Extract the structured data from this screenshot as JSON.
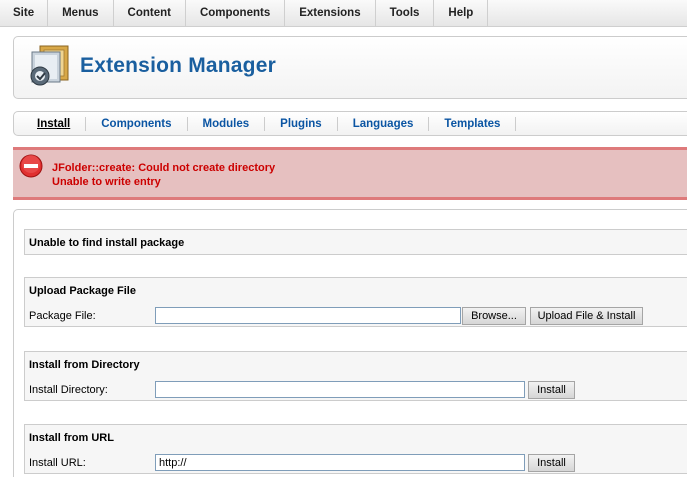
{
  "menu": {
    "items": [
      "Site",
      "Menus",
      "Content",
      "Components",
      "Extensions",
      "Tools",
      "Help"
    ]
  },
  "header": {
    "title": "Extension Manager",
    "icon": "install-package-icon"
  },
  "submenu": {
    "items": [
      "Install",
      "Components",
      "Modules",
      "Plugins",
      "Languages",
      "Templates"
    ],
    "active": "Install"
  },
  "error": {
    "icon": "error-stop-icon",
    "line1": "JFolder::create: Could not create directory",
    "line2": "Unable to write entry",
    "colors": {
      "background": "#e6c0c0",
      "border": "#de7a7b",
      "text": "#cc0000"
    }
  },
  "status": {
    "message": "Unable to find install package"
  },
  "upload": {
    "title": "Upload Package File",
    "label": "Package File:",
    "value": "",
    "browse_label": "Browse...",
    "submit_label": "Upload File & Install"
  },
  "directory": {
    "title": "Install from Directory",
    "label": "Install Directory:",
    "value": "",
    "submit_label": "Install"
  },
  "url": {
    "title": "Install from URL",
    "label": "Install URL:",
    "value": "http://",
    "submit_label": "Install"
  },
  "colors": {
    "title_blue": "#1a5f9f",
    "link_blue": "#0b55a3"
  }
}
